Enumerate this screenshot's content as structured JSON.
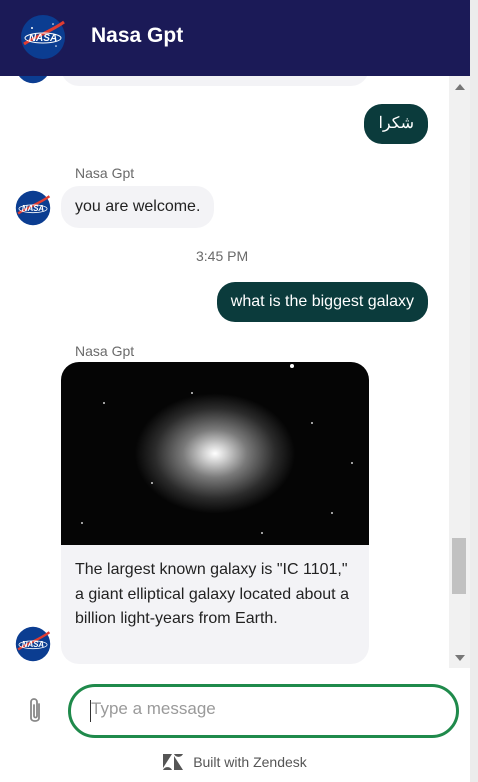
{
  "header": {
    "title": "Nasa Gpt",
    "logo_text": "NASA"
  },
  "messages": [
    {
      "from": "user",
      "text": "شكرا"
    },
    {
      "from": "bot",
      "sender": "Nasa Gpt",
      "text": "you are welcome."
    },
    {
      "timestamp": "3:45 PM"
    },
    {
      "from": "user",
      "text": "what is the biggest galaxy"
    },
    {
      "from": "bot",
      "sender": "Nasa Gpt",
      "image": "galaxy-photo",
      "text": "The largest known galaxy is \"IC 1101,\" a giant elliptical galaxy located about a billion light-years from Earth."
    }
  ],
  "composer": {
    "placeholder": "Type a message"
  },
  "footer": {
    "built_with": "Built with Zendesk"
  },
  "colors": {
    "header_bg": "#1b1a57",
    "user_bubble": "#0b3b3c",
    "bot_bubble": "#f3f3f6",
    "input_border": "#1f8a4b"
  }
}
